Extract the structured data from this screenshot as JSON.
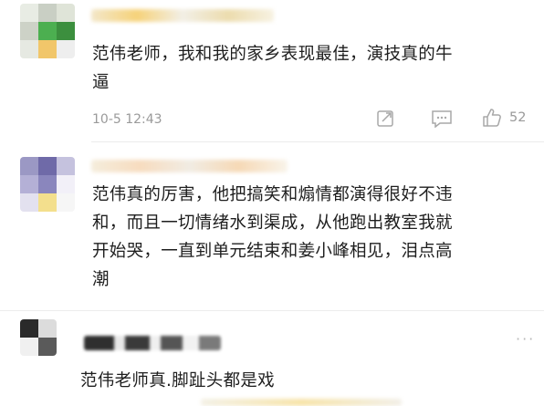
{
  "comments": [
    {
      "body": "范伟老师，我和我的家乡表现最佳，演技真的牛逼",
      "line1": "范伟老师，我和我的家乡表现最佳，演技真的牛",
      "line2": "逼",
      "timestamp": "10-5 12:43",
      "likes": "52",
      "icons": [
        "share-icon",
        "comment-icon",
        "like-icon"
      ]
    },
    {
      "line1": "范伟真的厉害，他把搞笑和煽情都演得很好不违",
      "line2": "和，而且一切情绪水到渠成，从他跑出教室我就",
      "line3": "开始哭，一直到单元结束和姜小峰相见，泪点高",
      "line4": "潮"
    },
    {
      "line1": "范伟老师真.脚趾头都是戏",
      "icons": [
        "more-icon"
      ],
      "more_glyph": "···"
    }
  ],
  "colors": {
    "text": "#1e1e1e",
    "meta": "#9a9a9a",
    "divider": "#ececec"
  }
}
